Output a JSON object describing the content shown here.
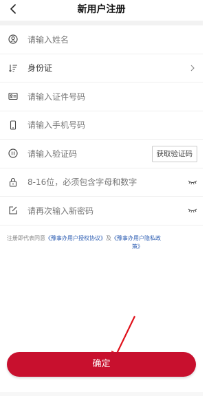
{
  "header": {
    "title": "新用户注册"
  },
  "form": {
    "name_placeholder": "请输入姓名",
    "id_type_value": "身份证",
    "id_number_placeholder": "请输入证件号码",
    "phone_placeholder": "请输入手机号码",
    "code_placeholder": "请输入验证码",
    "get_code_label": "获取验证码",
    "password_placeholder": "8-16位，必须包含字母和数字",
    "password_confirm_placeholder": "请再次输入新密码"
  },
  "agreement": {
    "prefix": "注册即代表同意",
    "link1": "《豫事办用户授权协议》",
    "and": "及",
    "link2_part1": "《豫事办用户隐私政",
    "link2_part2": "策》"
  },
  "footer": {
    "confirm_label": "确定"
  },
  "colors": {
    "primary": "#c8102e",
    "link": "#2f5fb3",
    "arrow": "#e0101a"
  },
  "icons": [
    "back-arrow-icon",
    "user-icon",
    "sort-icon",
    "id-card-icon",
    "phone-icon",
    "code-icon",
    "lock-icon",
    "edit-icon",
    "eye-closed-icon",
    "chevron-right-icon"
  ]
}
